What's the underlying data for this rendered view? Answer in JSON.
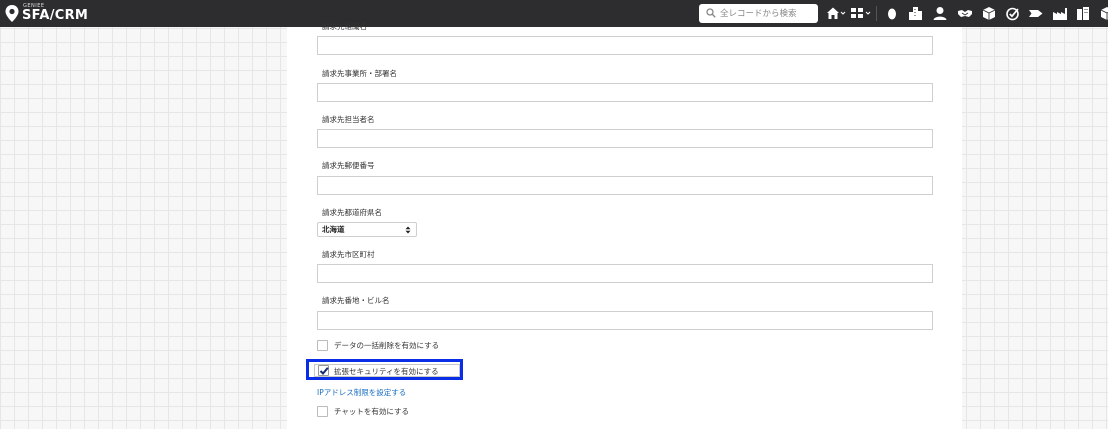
{
  "header": {
    "logo_sub": "GENIEE",
    "logo_main": "SFA/CRM",
    "search_placeholder": "全レコードから検索",
    "nav_icons": [
      "home-icon",
      "apps-grid-icon",
      "egg-icon",
      "building-icon",
      "person-icon",
      "handshake-icon",
      "box-icon",
      "check-circle-icon",
      "tag-icon",
      "factory-icon",
      "buildings-icon",
      "box-icon"
    ]
  },
  "form": {
    "fields": [
      {
        "label": "請求先組織名",
        "value": ""
      },
      {
        "label": "請求先事業所・部署名",
        "value": ""
      },
      {
        "label": "請求先担当者名",
        "value": ""
      },
      {
        "label": "請求先郵便番号",
        "value": ""
      },
      {
        "label": "請求先都道府県名",
        "value": "北海道"
      },
      {
        "label": "請求先市区町村",
        "value": ""
      },
      {
        "label": "請求先番地・ビル名",
        "value": ""
      }
    ],
    "checkboxes": [
      {
        "label": "データの一括削除を有効にする",
        "checked": false
      },
      {
        "label": "拡張セキュリティを有効にする",
        "checked": true
      },
      {
        "label": "チャットを有効にする",
        "checked": false
      }
    ],
    "ip_link": "IPアドレス制限を設定する"
  },
  "colors": {
    "topbar": "#2d2d30",
    "highlight": "#0a2ee8",
    "link": "#1a6ec0"
  }
}
